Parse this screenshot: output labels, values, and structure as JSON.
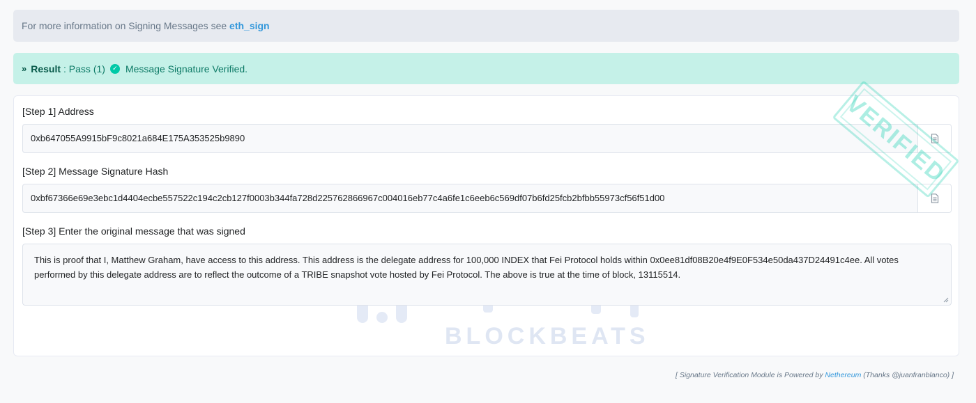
{
  "info": {
    "text": "For more information on Signing Messages see",
    "link": "eth_sign"
  },
  "result": {
    "chevron": "»",
    "label": "Result",
    "status": ": Pass (1)",
    "message": "Message Signature Verified."
  },
  "stamp": {
    "text": "VERIFIED",
    "color": "#00c9a7"
  },
  "watermark": {
    "brand": "律动",
    "text": "BLOCKBEATS"
  },
  "step1": {
    "label": "[Step 1] Address",
    "value": "0xb647055A9915bF9c8021a684E175A353525b9890",
    "copy_icon": "document-icon"
  },
  "step2": {
    "label": "[Step 2] Message Signature Hash",
    "value": "0xbf67366e69e3ebc1d4404ecbe557522c194c2cb127f0003b344fa728d225762866967c004016eb77c4a6fe1c6eeb6c569df07b6fd25fcb2bfbb55973cf56f51d00",
    "copy_icon": "document-icon"
  },
  "step3": {
    "label": "[Step 3] Enter the original message that was signed",
    "value": "This is proof that I, Matthew Graham, have access to this address. This address is the delegate address for 100,000 INDEX that Fei Protocol holds within 0x0ee81df08B20e4f9E0F534e50da437D24491c4ee. All votes performed by this delegate address are to reflect the outcome of a TRIBE snapshot vote hosted by Fei Protocol. The above is true at the time of block, 13115514."
  },
  "footer": {
    "prefix": "[ Signature Verification Module is Powered by",
    "link": "Nethereum",
    "suffix": "(Thanks @juanfranblanco) ]"
  }
}
